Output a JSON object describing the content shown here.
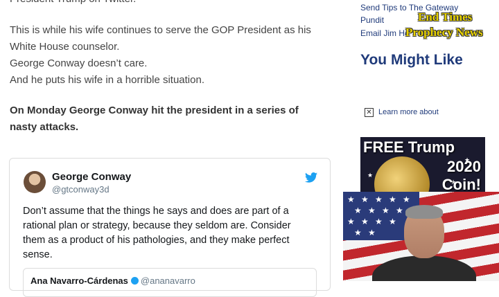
{
  "article": {
    "cut_line": "President Trump on Twitter.",
    "paragraph_lines": [
      "This is while his wife continues to serve the GOP President as his White House counselor.",
      "George Conway doesn’t care.",
      "And he puts his wife in a horrible situation."
    ],
    "bold_paragraph": "On Monday George Conway hit the president in a series of nasty attacks."
  },
  "tweet": {
    "name": "George Conway",
    "handle": "@gtconway3d",
    "body": "Don’t assume that the things he says and does are part of a rational plan or strategy, because they seldom are. Consider them as a product of his pathologies, and they make perfect sense.",
    "bird_icon": "twitter-bird-icon",
    "quoted_name": "Ana Navarro-Cárdenas",
    "quoted_handle": "@ananavarro"
  },
  "sidebar": {
    "tips_line1": "Send Tips to The Gateway",
    "tips_line2": "Pundit",
    "email_line": "Email Jim Ho",
    "you_might_like": "You Might Like",
    "ad_info": "Learn more about",
    "ad_banner_title": "FREE Trump",
    "ad_banner_year": "2020",
    "ad_banner_coin": "Coin!"
  },
  "watermark": {
    "line1": "End Times",
    "line2": "Prophecy News"
  },
  "colors": {
    "link": "#1f3a7a",
    "twitter_blue": "#1da1f2",
    "watermark_yellow": "#e8d200"
  }
}
